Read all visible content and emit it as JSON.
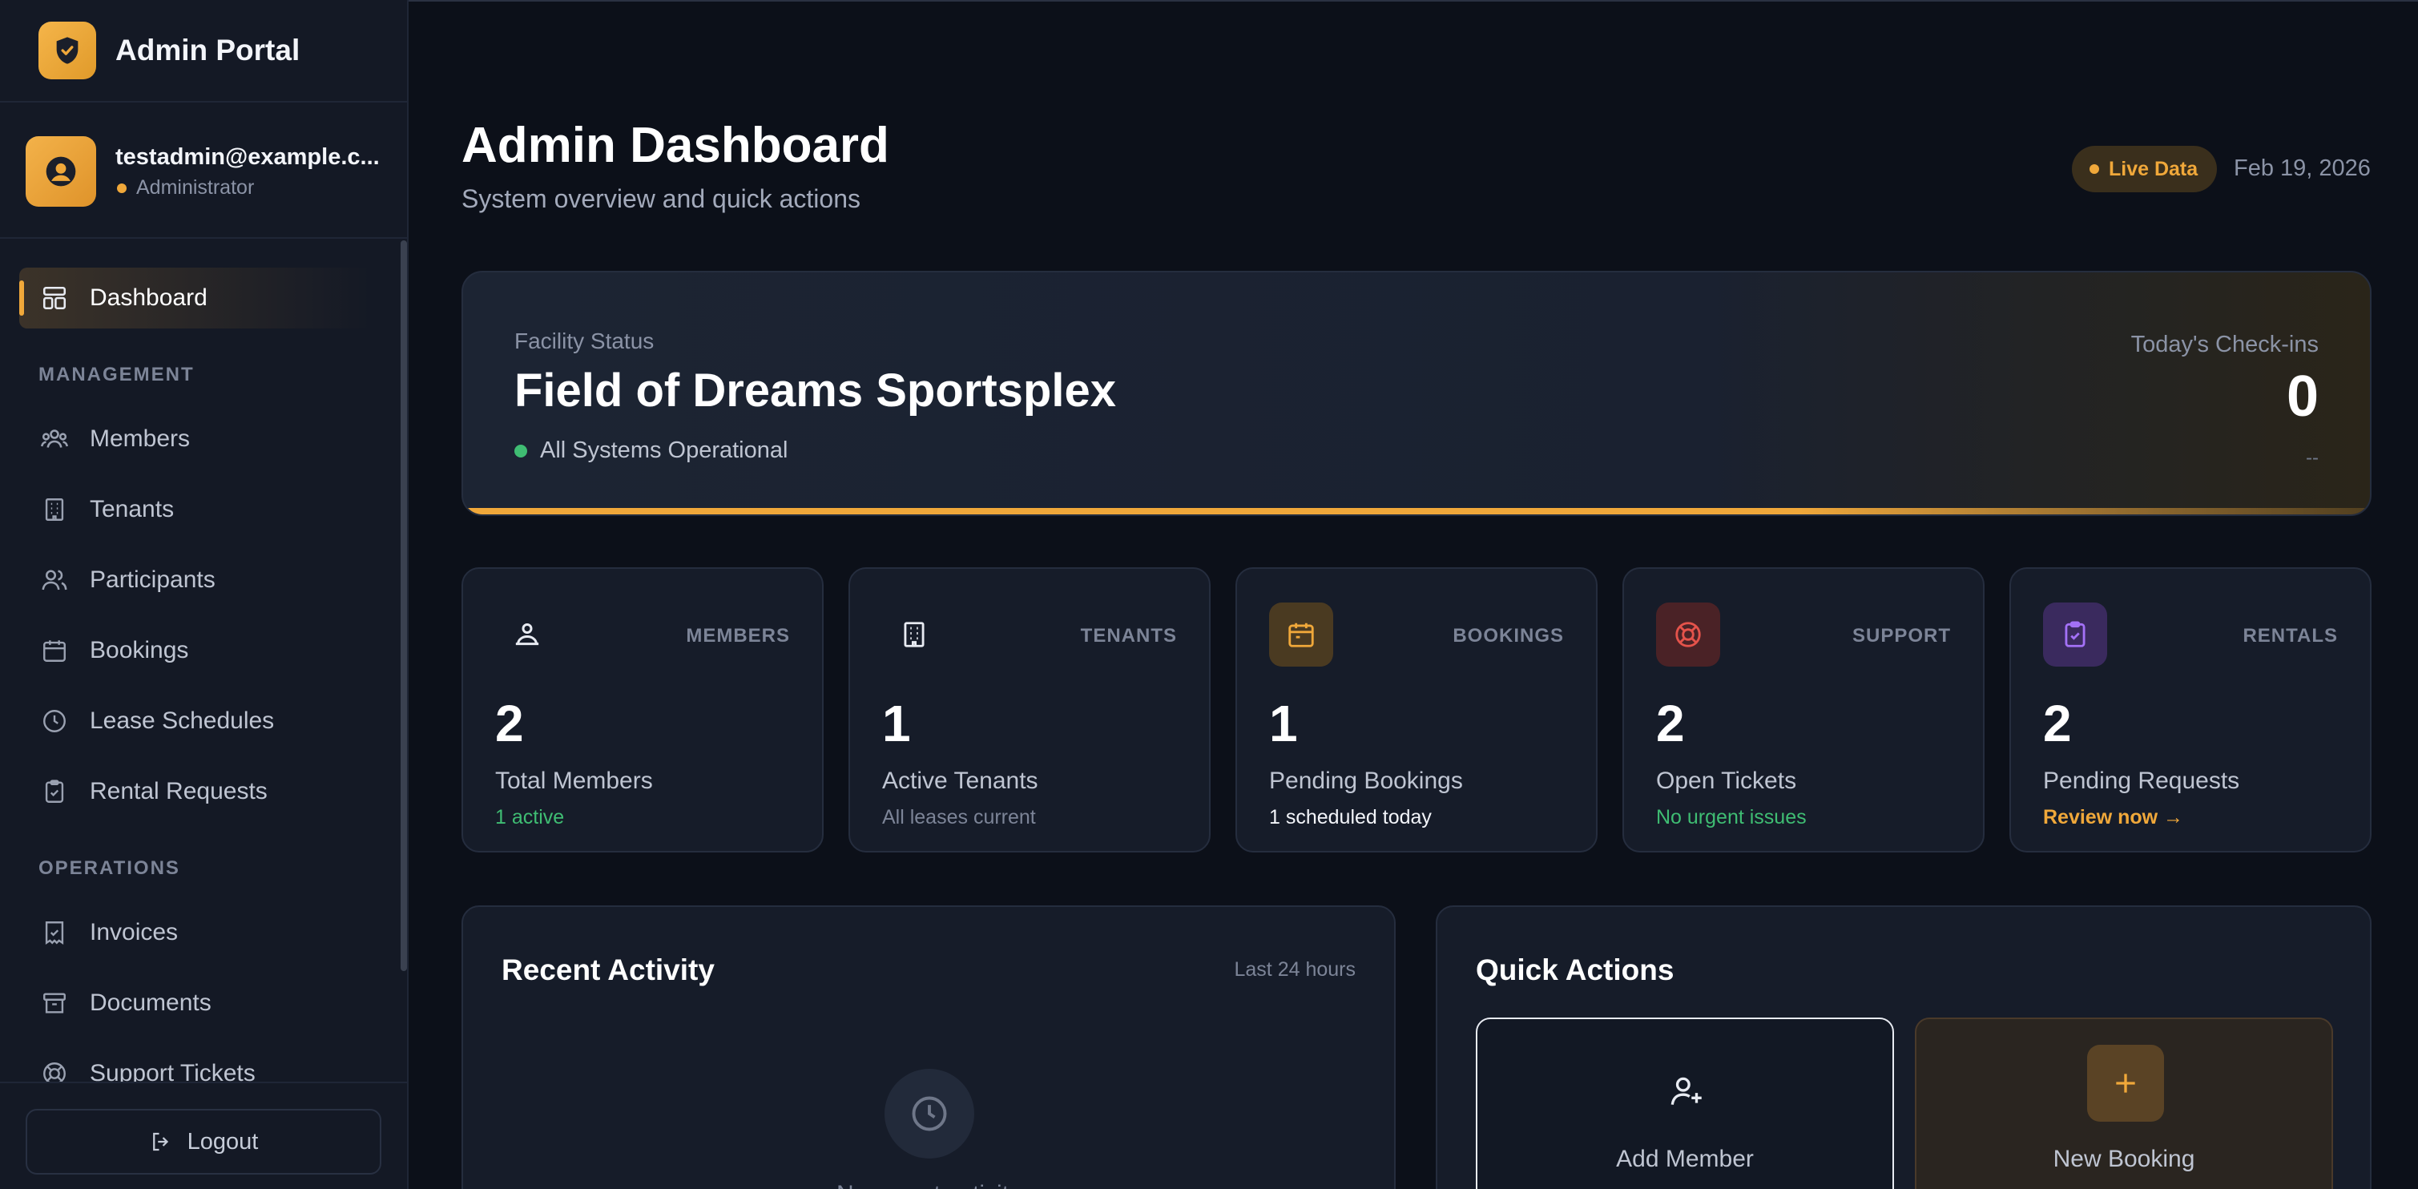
{
  "brand": {
    "title": "Admin Portal"
  },
  "user": {
    "email": "testadmin@example.c...",
    "role": "Administrator"
  },
  "nav": {
    "dashboard": "Dashboard",
    "section_management": "MANAGEMENT",
    "members": "Members",
    "tenants": "Tenants",
    "participants": "Participants",
    "bookings": "Bookings",
    "lease_schedules": "Lease Schedules",
    "rental_requests": "Rental Requests",
    "section_operations": "OPERATIONS",
    "invoices": "Invoices",
    "documents": "Documents",
    "support_tickets": "Support Tickets"
  },
  "logout_label": "Logout",
  "header": {
    "title": "Admin Dashboard",
    "subtitle": "System overview and quick actions",
    "badge": "Live Data",
    "date": "Feb 19, 2026"
  },
  "facility": {
    "label": "Facility Status",
    "name": "Field of Dreams Sportsplex",
    "status": "All Systems Operational",
    "checkins_label": "Today's Check-ins",
    "checkins_value": "0",
    "checkins_sub": "--"
  },
  "stats": [
    {
      "caption": "MEMBERS",
      "value": "2",
      "label": "Total Members",
      "sub": "1 active",
      "sub_color": "#3fbd73",
      "icon": "members-icon"
    },
    {
      "caption": "TENANTS",
      "value": "1",
      "label": "Active Tenants",
      "sub": "All leases current",
      "sub_color": "#7c8497",
      "icon": "building-icon"
    },
    {
      "caption": "BOOKINGS",
      "value": "1",
      "label": "Pending Bookings",
      "sub": "1 scheduled today",
      "sub_color": "#f3f5fa",
      "icon": "calendar-icon"
    },
    {
      "caption": "SUPPORT",
      "value": "2",
      "label": "Open Tickets",
      "sub": "No urgent issues",
      "sub_color": "#3fbd73",
      "icon": "lifebuoy-icon"
    },
    {
      "caption": "RENTALS",
      "value": "2",
      "label": "Pending Requests",
      "sub": "Review now →",
      "sub_color": "#f0a83a",
      "icon": "clipboard-check-icon"
    }
  ],
  "recent_activity": {
    "title": "Recent Activity",
    "meta": "Last 24 hours",
    "empty": "No recent activity"
  },
  "quick_actions": {
    "title": "Quick Actions",
    "add_member": "Add Member",
    "new_booking": "New Booking"
  },
  "colors": {
    "accent": "#f0a83a",
    "success": "#3fbd73",
    "danger": "#e5534b",
    "purple": "#a371f7",
    "background": "#0c1019",
    "sidebar": "#141925",
    "card": "#161c29"
  }
}
